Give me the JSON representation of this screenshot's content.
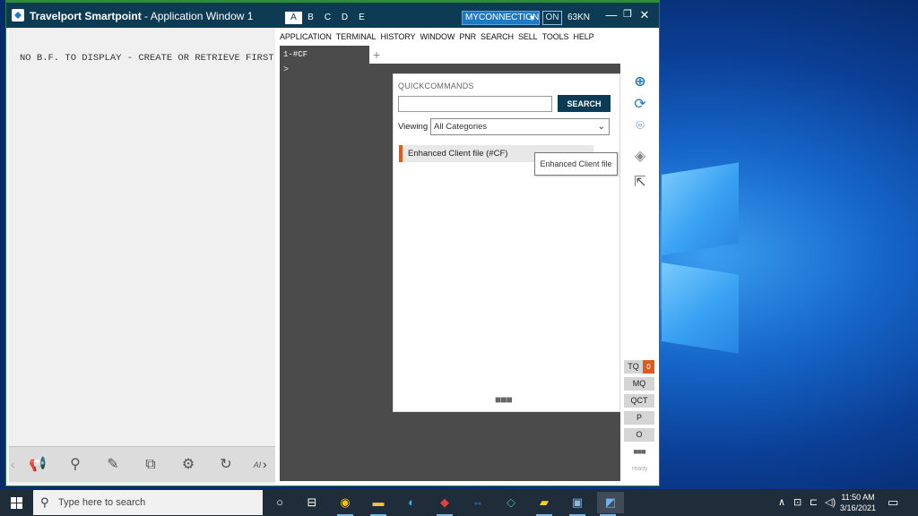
{
  "window": {
    "title_bold": "Travelport Smartpoint",
    "title_rest": " - Application Window 1",
    "sessions": [
      "A",
      "B",
      "C",
      "D",
      "E"
    ],
    "active_session": "A",
    "connection": "MYCONNECTION",
    "on_label": "ON",
    "kn_label": "63KN",
    "min_icon": "—",
    "restore_icon": "❐",
    "close_icon": "✕"
  },
  "menu": [
    "APPLICATION",
    "TERMINAL",
    "HISTORY",
    "WINDOW",
    "PNR",
    "SEARCH",
    "SELL",
    "TOOLS",
    "HELP"
  ],
  "left_pane": {
    "message": "NO B.F. TO DISPLAY - CREATE OR RETRIEVE FIRST",
    "toolbar": [
      "megaphone-icon",
      "magnifier-icon",
      "pencil-icon",
      "copy-icon",
      "gear-icon",
      "refresh-icon",
      "ai-icon"
    ],
    "toolbar_partial_label": "AI"
  },
  "terminal": {
    "tab_label": "1-#CF",
    "add_tab": "+",
    "prompt": ">"
  },
  "quick_commands": {
    "title": "QUICKCOMMANDS",
    "search_value": "",
    "search_button": "SEARCH",
    "viewing_label": "Viewing",
    "viewing_value": "All Categories",
    "item": "Enhanced Client file (#CF)",
    "tooltip": "Enhanced Client file",
    "more": "■■■"
  },
  "right_bar": {
    "icons": [
      "hash-icon",
      "sync-icon",
      "map-pin-icon",
      "ticket-icon",
      "external-link-icon"
    ],
    "buttons": [
      "TQ",
      "MQ",
      "QCT",
      "P",
      "O"
    ],
    "tq_count": "0",
    "more": "■■■",
    "status": "ready"
  },
  "taskbar": {
    "search_placeholder": "Type here to search",
    "time": "11:50 AM",
    "date": "3/16/2021",
    "accent": "#76b9ed"
  }
}
